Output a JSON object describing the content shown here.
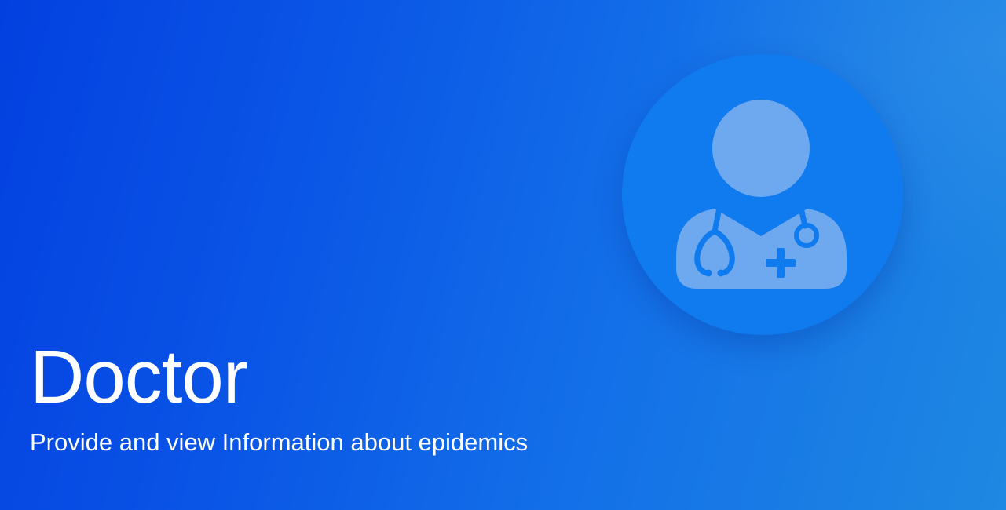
{
  "hero": {
    "title": "Doctor",
    "subtitle": "Provide and view Information about epidemics",
    "icon": "doctor-icon",
    "colors": {
      "background_start": "#0340e0",
      "background_end": "#1e88e2",
      "circle": "#0f7bee",
      "icon_fill": "#6ea9f0",
      "text": "#ffffff"
    }
  }
}
